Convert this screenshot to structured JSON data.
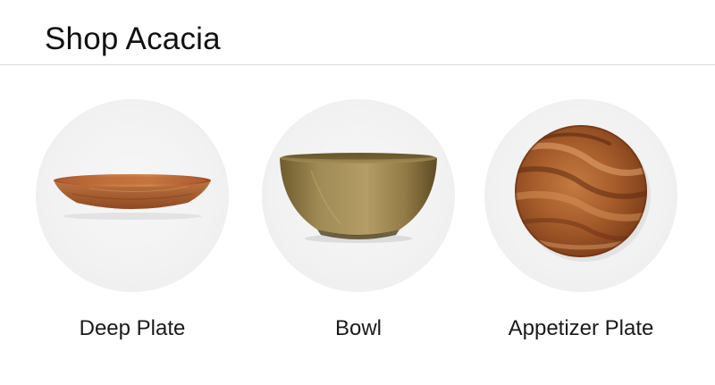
{
  "header": {
    "title": "Shop Acacia"
  },
  "products": [
    {
      "label": "Deep Plate",
      "image": "deep-plate-image"
    },
    {
      "label": "Bowl",
      "image": "bowl-image"
    },
    {
      "label": "Appetizer Plate",
      "image": "appetizer-plate-image"
    }
  ],
  "colors": {
    "background": "#ffffff",
    "divider": "#d9d9d9",
    "circle": "#f2f2f2",
    "acacia_light": "#c8854a",
    "acacia_dark": "#7a3d1c",
    "bowl_wood": "#9b8450"
  }
}
